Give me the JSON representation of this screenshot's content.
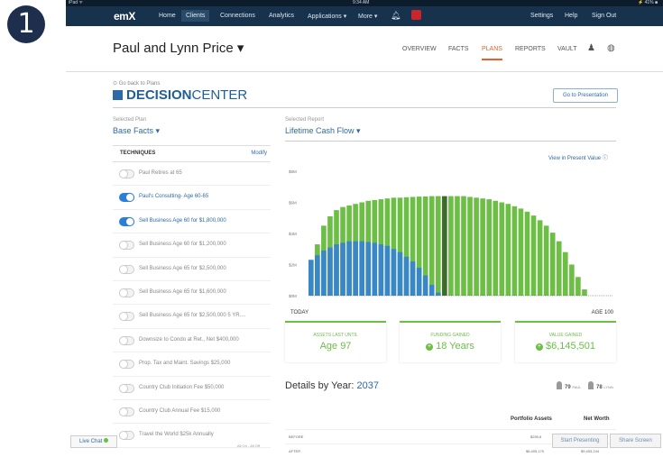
{
  "badge": "1",
  "status": {
    "left": "iPad ᯤ",
    "time": "9:34 AM",
    "right": "⚡ 41% ■"
  },
  "topnav": {
    "logo": "emX",
    "items": [
      "Home",
      "Clients",
      "Connections",
      "Analytics",
      "Applications ▾",
      "More ▾"
    ],
    "right": [
      "Settings",
      "Help",
      "Sign Out"
    ]
  },
  "client_name": "Paul and Lynn Price ▾",
  "tabs": [
    "OVERVIEW",
    "FACTS",
    "PLANS",
    "REPORTS",
    "VAULT"
  ],
  "back_link": "Go back to Plans",
  "decision_center": {
    "bold": "DECISION",
    "light": "CENTER"
  },
  "go_presentation": "Go to Presentation",
  "selected_plan": {
    "label": "Selected Plan",
    "value": "Base Facts ▾"
  },
  "selected_report": {
    "label": "Selected Report",
    "value": "Lifetime Cash Flow ▾"
  },
  "techniques": {
    "title": "TECHNIQUES",
    "modify": "Modify",
    "rows": [
      {
        "label": "Paul Retires at 65",
        "on": false
      },
      {
        "label": "Paul's Consulting- Age 60-65",
        "on": true
      },
      {
        "label": "Sell Business Age 60 for $1,800,000",
        "on": true
      },
      {
        "label": "Sell Business Age 60 for $1,200,000",
        "on": false
      },
      {
        "label": "Sell Business Age 65 for $2,500,000",
        "on": false
      },
      {
        "label": "Sell Business Age 65 for $1,600,000",
        "on": false
      },
      {
        "label": "Sell Business Age 65 for $2,500,000 5 YR....",
        "on": false
      },
      {
        "label": "Downsize to Condo at Ret., Net $400,000",
        "on": false
      },
      {
        "label": "Prop. Tax and Maint. Savings $25,000",
        "on": false
      },
      {
        "label": "Country Club Initiation Fee $50,000",
        "on": false
      },
      {
        "label": "Country Club Annual Fee $15,000",
        "on": false
      },
      {
        "label": "Travel the World $25k Annually",
        "on": false
      }
    ],
    "footer": "All On - All Off"
  },
  "view_present_value": "View in Present Value ⓘ",
  "chart_data": {
    "type": "bar",
    "title": "",
    "xlabel_left": "TODAY",
    "xlabel_right": "AGE 100",
    "yticks": [
      "$0M",
      "$2M",
      "$4M",
      "$6M",
      "$8M"
    ],
    "ylim": [
      0,
      8
    ],
    "colors": {
      "green": "#6cbe45",
      "blue": "#3a87c8",
      "divider": "#3d6b2c",
      "dark": "#1f3f6a"
    },
    "series": [
      {
        "name": "green",
        "values": [
          2.3,
          3.3,
          4.5,
          5.1,
          5.5,
          5.7,
          5.8,
          5.9,
          6.0,
          6.1,
          6.15,
          6.2,
          6.25,
          6.3,
          6.3,
          6.33,
          6.35,
          6.37,
          6.38,
          6.4,
          6.4,
          6.4,
          6.4,
          6.4,
          6.4,
          6.35,
          6.3,
          6.25,
          6.2,
          6.1,
          6.0,
          5.9,
          5.75,
          5.6,
          5.4,
          5.15,
          4.85,
          4.5,
          4.05,
          3.5,
          2.8,
          2.0,
          1.2,
          0.4
        ]
      },
      {
        "name": "blue",
        "values": [
          2.3,
          2.6,
          2.9,
          3.1,
          3.3,
          3.4,
          3.5,
          3.5,
          3.5,
          3.45,
          3.4,
          3.3,
          3.2,
          3.0,
          2.8,
          2.5,
          2.2,
          1.8,
          1.3,
          0.7,
          0.2,
          0,
          0,
          0,
          0,
          0,
          0,
          0,
          0,
          0,
          0,
          0,
          0,
          0,
          0,
          0,
          0,
          0,
          0,
          0,
          0,
          0,
          0,
          0
        ]
      }
    ]
  },
  "cards": [
    {
      "title": "ASSETS LAST UNTIL",
      "value": "Age 97",
      "icon": ""
    },
    {
      "title": "FUNDING GAINED",
      "value": "18 Years",
      "icon": "+"
    },
    {
      "title": "VALUE GAINED",
      "value": "$6,145,501",
      "icon": "+"
    }
  ],
  "details": {
    "label": "Details by Year:",
    "year": "2037"
  },
  "ages": [
    {
      "n": "79",
      "who": "PAUL"
    },
    {
      "n": "78",
      "who": "LYNN"
    }
  ],
  "table": {
    "headers": [
      "Portfolio Assets",
      "Net Worth"
    ],
    "rows": [
      {
        "label": "BEFORE",
        "a": "$259,6",
        "b": "90"
      },
      {
        "label": "AFTER",
        "a": "$6,405,170",
        "b": "$9,453,244"
      }
    ]
  },
  "live_chat": "Live Chat",
  "start_presenting": "Start Presenting",
  "share_screen": "Share Screen"
}
